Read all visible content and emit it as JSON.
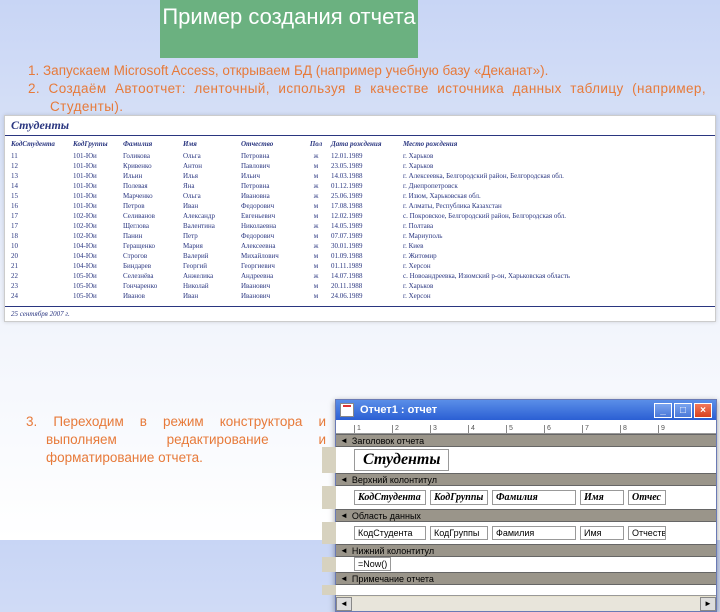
{
  "banner": {
    "title": "Пример создания отчета"
  },
  "steps": {
    "s1_num": "1.",
    "s1": "Запускаем Microsoft Access, открываем БД (например учебную базу «Деканат»).",
    "s2_num": "2.",
    "s2": "Создаём Автоотчет: ленточный, используя в качестве источника данных таблицу (например, Студенты).",
    "s3_num": "3.",
    "s3": "Переходим в режим конструктора и выполняем редактирование и форматирование отчета."
  },
  "report": {
    "title": "Студенты",
    "cols": [
      "КодСтудента",
      "КодГруппы",
      "Фамилия",
      "Имя",
      "Отчество",
      "Пол",
      "Дата рождения",
      "Место рождения"
    ],
    "rows": [
      [
        "11",
        "101-Юи",
        "Голикова",
        "Ольга",
        "Петровна",
        "ж",
        "12.01.1989",
        "г. Харьков"
      ],
      [
        "12",
        "101-Юи",
        "Кривенко",
        "Антон",
        "Павлович",
        "м",
        "23.05.1989",
        "г. Харьков"
      ],
      [
        "13",
        "101-Юи",
        "Ильин",
        "Илья",
        "Ильич",
        "м",
        "14.03.1988",
        "г. Алексеевка, Белгородский район, Белгородская обл."
      ],
      [
        "14",
        "101-Юи",
        "Полевая",
        "Яна",
        "Петровна",
        "ж",
        "01.12.1989",
        "г. Днепропетровск"
      ],
      [
        "15",
        "101-Юи",
        "Марченко",
        "Ольга",
        "Ивановна",
        "ж",
        "25.06.1989",
        "г. Изюм, Харьковская обл."
      ],
      [
        "16",
        "101-Юи",
        "Петров",
        "Иван",
        "Федорович",
        "м",
        "17.08.1988",
        "г. Алматы, Республика Казахстан"
      ],
      [
        "17",
        "102-Юи",
        "Селиванов",
        "Александр",
        "Евгеньевич",
        "м",
        "12.02.1989",
        "с. Покровское, Белгородский район, Белгородская обл."
      ],
      [
        "17",
        "102-Юи",
        "Щеглова",
        "Валентина",
        "Николаевна",
        "ж",
        "14.05.1989",
        "г. Полтава"
      ],
      [
        "18",
        "102-Юи",
        "Панин",
        "Петр",
        "Федорович",
        "м",
        "07.07.1989",
        "г. Мариуполь"
      ],
      [
        "10",
        "104-Юи",
        "Геращенко",
        "Мария",
        "Алексеевна",
        "ж",
        "30.01.1989",
        "г. Киев"
      ],
      [
        "20",
        "104-Юи",
        "Строгов",
        "Валерий",
        "Михайлович",
        "м",
        "01.09.1988",
        "г. Житомир"
      ],
      [
        "21",
        "104-Юи",
        "Биндарев",
        "Георгий",
        "Георгиевич",
        "м",
        "01.11.1989",
        "г. Херсон"
      ],
      [
        "22",
        "105-Юи",
        "Селезнёва",
        "Анжелика",
        "Андреевна",
        "ж",
        "14.07.1988",
        "с. Новоандреевка, Изюмский р-он, Харьковская область"
      ],
      [
        "23",
        "105-Юи",
        "Гончаренко",
        "Николай",
        "Иванович",
        "м",
        "20.11.1988",
        "г. Харьков"
      ],
      [
        "24",
        "105-Юи",
        "Иванов",
        "Иван",
        "Иванович",
        "м",
        "24.06.1989",
        "г. Херсон"
      ]
    ],
    "footer": "25 сентября 2007 г."
  },
  "access": {
    "title": "Отчет1 : отчет",
    "ruler": [
      "1",
      "2",
      "3",
      "4",
      "5",
      "6",
      "7",
      "8",
      "9"
    ],
    "sections": {
      "head": "Заголовок отчета",
      "top": "Верхний колонтитул",
      "data": "Область данных",
      "bottom": "Нижний колонтитул",
      "note": "Примечание отчета"
    },
    "title_label": "Студенты",
    "labels": [
      "КодСтудента",
      "КодГруппы",
      "Фамилия",
      "Имя",
      "Отчес"
    ],
    "fields": [
      "КодСтудента",
      "КодГруппы",
      "Фамилия",
      "Имя",
      "Отчеств"
    ],
    "now": "=Now()",
    "btn": {
      "min": "_",
      "max": "□",
      "close": "×"
    }
  }
}
